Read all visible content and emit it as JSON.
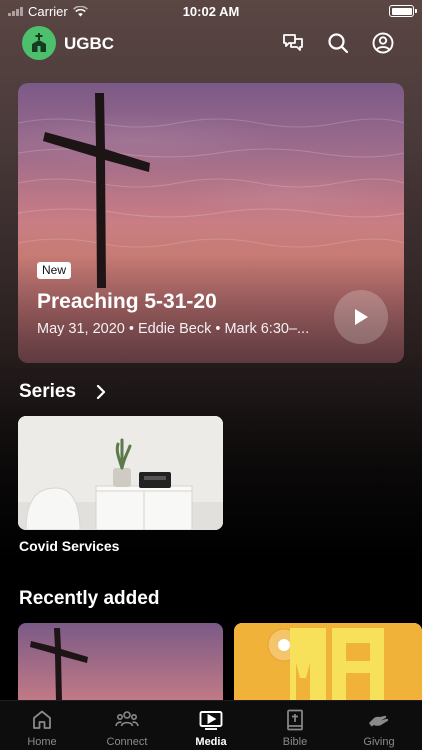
{
  "status_bar": {
    "carrier": "Carrier",
    "time": "10:02 AM"
  },
  "header": {
    "app_name": "UGBC"
  },
  "hero": {
    "badge": "New",
    "title": "Preaching 5-31-20",
    "meta": "May 31, 2020 • Eddie Beck • Mark 6:30–..."
  },
  "series": {
    "title": "Series",
    "items": [
      {
        "label": "Covid Services"
      }
    ]
  },
  "recently_added": {
    "title": "Recently added"
  },
  "tabs": [
    {
      "label": "Home",
      "icon": "home-icon",
      "active": false
    },
    {
      "label": "Connect",
      "icon": "people-icon",
      "active": false
    },
    {
      "label": "Media",
      "icon": "play-icon",
      "active": true
    },
    {
      "label": "Bible",
      "icon": "bible-icon",
      "active": false
    },
    {
      "label": "Giving",
      "icon": "giving-icon",
      "active": false
    }
  ],
  "colors": {
    "accent_logo": "#4cc06d",
    "tab_active": "#ffffff",
    "tab_inactive": "#8a8a8a",
    "giving_card": "#f1b23a"
  }
}
